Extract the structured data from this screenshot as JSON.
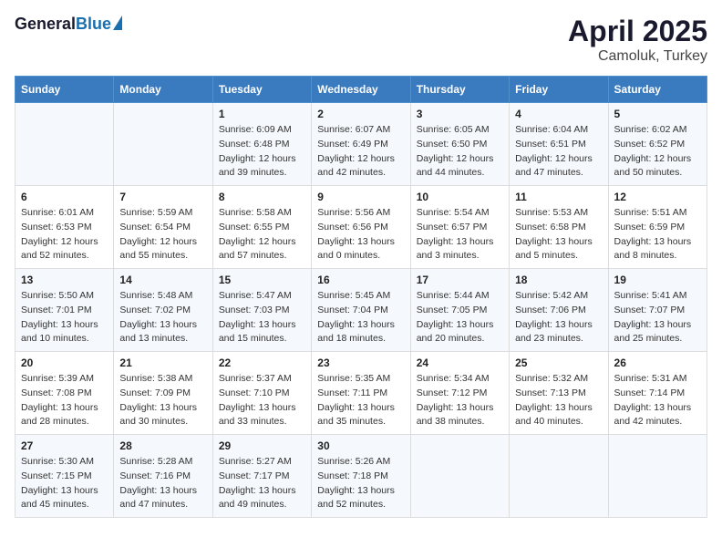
{
  "header": {
    "logo_general": "General",
    "logo_blue": "Blue",
    "title": "April 2025",
    "subtitle": "Camoluk, Turkey"
  },
  "weekdays": [
    "Sunday",
    "Monday",
    "Tuesday",
    "Wednesday",
    "Thursday",
    "Friday",
    "Saturday"
  ],
  "weeks": [
    [
      {
        "num": "",
        "detail": ""
      },
      {
        "num": "",
        "detail": ""
      },
      {
        "num": "1",
        "detail": "Sunrise: 6:09 AM\nSunset: 6:48 PM\nDaylight: 12 hours\nand 39 minutes."
      },
      {
        "num": "2",
        "detail": "Sunrise: 6:07 AM\nSunset: 6:49 PM\nDaylight: 12 hours\nand 42 minutes."
      },
      {
        "num": "3",
        "detail": "Sunrise: 6:05 AM\nSunset: 6:50 PM\nDaylight: 12 hours\nand 44 minutes."
      },
      {
        "num": "4",
        "detail": "Sunrise: 6:04 AM\nSunset: 6:51 PM\nDaylight: 12 hours\nand 47 minutes."
      },
      {
        "num": "5",
        "detail": "Sunrise: 6:02 AM\nSunset: 6:52 PM\nDaylight: 12 hours\nand 50 minutes."
      }
    ],
    [
      {
        "num": "6",
        "detail": "Sunrise: 6:01 AM\nSunset: 6:53 PM\nDaylight: 12 hours\nand 52 minutes."
      },
      {
        "num": "7",
        "detail": "Sunrise: 5:59 AM\nSunset: 6:54 PM\nDaylight: 12 hours\nand 55 minutes."
      },
      {
        "num": "8",
        "detail": "Sunrise: 5:58 AM\nSunset: 6:55 PM\nDaylight: 12 hours\nand 57 minutes."
      },
      {
        "num": "9",
        "detail": "Sunrise: 5:56 AM\nSunset: 6:56 PM\nDaylight: 13 hours\nand 0 minutes."
      },
      {
        "num": "10",
        "detail": "Sunrise: 5:54 AM\nSunset: 6:57 PM\nDaylight: 13 hours\nand 3 minutes."
      },
      {
        "num": "11",
        "detail": "Sunrise: 5:53 AM\nSunset: 6:58 PM\nDaylight: 13 hours\nand 5 minutes."
      },
      {
        "num": "12",
        "detail": "Sunrise: 5:51 AM\nSunset: 6:59 PM\nDaylight: 13 hours\nand 8 minutes."
      }
    ],
    [
      {
        "num": "13",
        "detail": "Sunrise: 5:50 AM\nSunset: 7:01 PM\nDaylight: 13 hours\nand 10 minutes."
      },
      {
        "num": "14",
        "detail": "Sunrise: 5:48 AM\nSunset: 7:02 PM\nDaylight: 13 hours\nand 13 minutes."
      },
      {
        "num": "15",
        "detail": "Sunrise: 5:47 AM\nSunset: 7:03 PM\nDaylight: 13 hours\nand 15 minutes."
      },
      {
        "num": "16",
        "detail": "Sunrise: 5:45 AM\nSunset: 7:04 PM\nDaylight: 13 hours\nand 18 minutes."
      },
      {
        "num": "17",
        "detail": "Sunrise: 5:44 AM\nSunset: 7:05 PM\nDaylight: 13 hours\nand 20 minutes."
      },
      {
        "num": "18",
        "detail": "Sunrise: 5:42 AM\nSunset: 7:06 PM\nDaylight: 13 hours\nand 23 minutes."
      },
      {
        "num": "19",
        "detail": "Sunrise: 5:41 AM\nSunset: 7:07 PM\nDaylight: 13 hours\nand 25 minutes."
      }
    ],
    [
      {
        "num": "20",
        "detail": "Sunrise: 5:39 AM\nSunset: 7:08 PM\nDaylight: 13 hours\nand 28 minutes."
      },
      {
        "num": "21",
        "detail": "Sunrise: 5:38 AM\nSunset: 7:09 PM\nDaylight: 13 hours\nand 30 minutes."
      },
      {
        "num": "22",
        "detail": "Sunrise: 5:37 AM\nSunset: 7:10 PM\nDaylight: 13 hours\nand 33 minutes."
      },
      {
        "num": "23",
        "detail": "Sunrise: 5:35 AM\nSunset: 7:11 PM\nDaylight: 13 hours\nand 35 minutes."
      },
      {
        "num": "24",
        "detail": "Sunrise: 5:34 AM\nSunset: 7:12 PM\nDaylight: 13 hours\nand 38 minutes."
      },
      {
        "num": "25",
        "detail": "Sunrise: 5:32 AM\nSunset: 7:13 PM\nDaylight: 13 hours\nand 40 minutes."
      },
      {
        "num": "26",
        "detail": "Sunrise: 5:31 AM\nSunset: 7:14 PM\nDaylight: 13 hours\nand 42 minutes."
      }
    ],
    [
      {
        "num": "27",
        "detail": "Sunrise: 5:30 AM\nSunset: 7:15 PM\nDaylight: 13 hours\nand 45 minutes."
      },
      {
        "num": "28",
        "detail": "Sunrise: 5:28 AM\nSunset: 7:16 PM\nDaylight: 13 hours\nand 47 minutes."
      },
      {
        "num": "29",
        "detail": "Sunrise: 5:27 AM\nSunset: 7:17 PM\nDaylight: 13 hours\nand 49 minutes."
      },
      {
        "num": "30",
        "detail": "Sunrise: 5:26 AM\nSunset: 7:18 PM\nDaylight: 13 hours\nand 52 minutes."
      },
      {
        "num": "",
        "detail": ""
      },
      {
        "num": "",
        "detail": ""
      },
      {
        "num": "",
        "detail": ""
      }
    ]
  ]
}
